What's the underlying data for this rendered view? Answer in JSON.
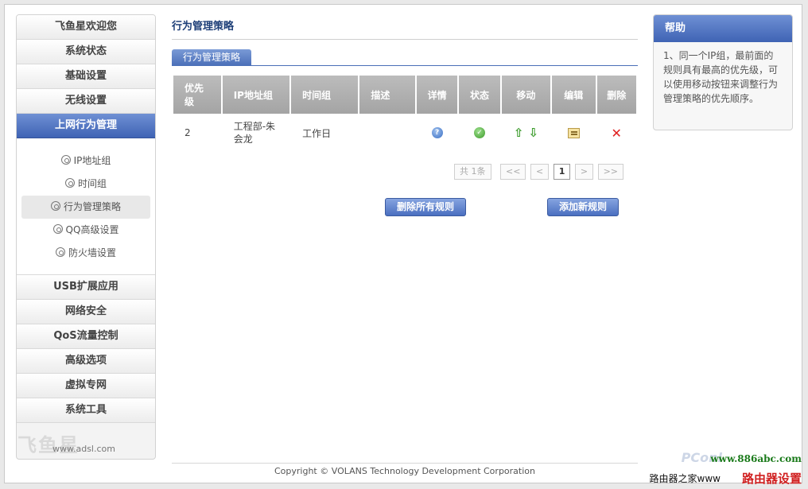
{
  "sidebar": {
    "top_items": [
      {
        "label": "飞鱼星欢迎您"
      },
      {
        "label": "系统状态"
      },
      {
        "label": "基础设置"
      },
      {
        "label": "无线设置"
      },
      {
        "label": "上网行为管理"
      }
    ],
    "sub_items": [
      {
        "label": "IP地址组"
      },
      {
        "label": "时间组"
      },
      {
        "label": "行为管理策略"
      },
      {
        "label": "QQ高级设置"
      },
      {
        "label": "防火墙设置"
      }
    ],
    "bottom_items": [
      {
        "label": "USB扩展应用"
      },
      {
        "label": "网络安全"
      },
      {
        "label": "QoS流量控制"
      },
      {
        "label": "高级选项"
      },
      {
        "label": "虚拟专网"
      },
      {
        "label": "系统工具"
      }
    ],
    "logo_text": "飞鱼星",
    "logo_small": "www.adsl.com"
  },
  "main": {
    "title": "行为管理策略",
    "tab_label": "行为管理策略",
    "columns": [
      "优先级",
      "IP地址组",
      "时间组",
      "描述",
      "详情",
      "状态",
      "移动",
      "编辑",
      "删除"
    ],
    "rows": [
      {
        "priority": "2",
        "ip_group": "工程部-朱会龙",
        "time_group": "工作日",
        "description": ""
      }
    ],
    "pager": {
      "total": "共 1条",
      "first": "<<",
      "prev": "<",
      "current": "1",
      "next": ">",
      "last": ">>"
    },
    "buttons": {
      "delete_all": "删除所有规则",
      "add_new": "添加新规则"
    }
  },
  "help": {
    "title": "帮助",
    "text": "1、同一个IP组，最前面的规则具有最高的优先级，可以使用移动按钮来调整行为管理策略的优先顺序。"
  },
  "footer": {
    "copyright": "Copyright © VOLANS Technology Development Corporation"
  },
  "watermarks": {
    "site": "www.886abc.com",
    "cn": "路由器设置",
    "home": "路由器之家www",
    "pc": "PConl"
  },
  "icons": {
    "info": "info-icon",
    "status": "check-icon",
    "move_up": "arrow-up-icon",
    "move_down": "arrow-down-icon",
    "edit": "edit-icon",
    "delete": "delete-icon"
  },
  "colors": {
    "accent": "#3f63b4",
    "header_gray": "#a4a4a4",
    "delete_red": "#e02020",
    "ok_green": "#3d9a2a"
  }
}
